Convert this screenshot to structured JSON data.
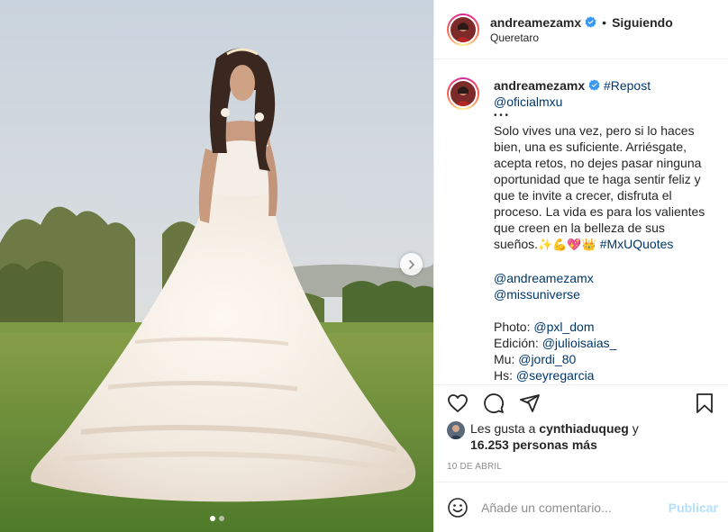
{
  "post": {
    "author": {
      "username": "andreamezamx",
      "verified": true,
      "follow_status": "Siguiendo",
      "separator": "•",
      "location": "Queretaro"
    },
    "caption": {
      "username": "andreamezamx",
      "hashtag_repost": "#Repost",
      "mention_source": "@oficialmxu",
      "dots": "• • •",
      "lines": [
        "Solo vives una vez, pero si lo haces",
        "bien, una es suficiente. Arriésgate,",
        "acepta retos, no dejes pasar ninguna",
        "oportunidad que te haga sentir feliz y",
        "que te invite a crecer, disfruta el",
        "proceso. La vida es para los valientes",
        "que creen en la belleza de sus"
      ],
      "last_line_text": "sueños.",
      "emojis": "✨💪💖👑",
      "hashtag": "#MxUQuotes",
      "mention_1": "@andreamezamx",
      "mention_2": "@missuniverse",
      "photo_label": "Photo: ",
      "photo_handle": "@pxl_dom",
      "edit_label": "Edición: ",
      "edit_handle": "@julioisaias_",
      "mu_label": "Mu: ",
      "mu_handle": "@jordi_80",
      "hs_label": "Hs: ",
      "hs_handle": "@seyregarcia"
    },
    "likes": {
      "prefix": "Les gusta a ",
      "first_user": "cynthiaduqueg",
      "conjunction": " y",
      "count_text": "16.253 personas más"
    },
    "date": "10 DE ABRIL",
    "comment_input": {
      "placeholder": "Añade un comentario...",
      "value": ""
    },
    "publish_label": "Publicar",
    "carousel": {
      "total": 2,
      "current": 1
    },
    "colors": {
      "link": "#00376b",
      "publish_disabled": "#b2dffc",
      "muted": "#8e8e8e",
      "verified": "#3897f0"
    },
    "icons": {
      "like": "heart-icon",
      "comment": "comment-icon",
      "share": "share-icon",
      "save": "bookmark-icon",
      "emoji": "emoji-smile-icon",
      "next": "chevron-right-icon",
      "verified": "verified-badge-icon"
    }
  }
}
